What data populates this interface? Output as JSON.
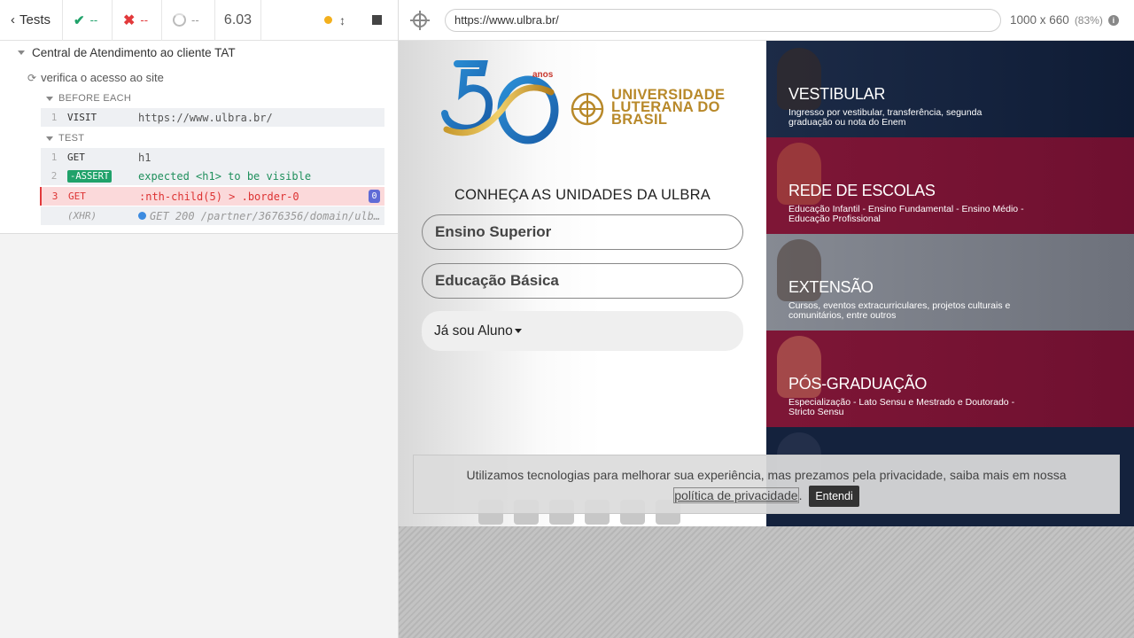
{
  "reporter": {
    "back_label": "Tests",
    "passed": "--",
    "failed": "--",
    "pending": "--",
    "duration": "6.03",
    "suite_title": "Central de Atendimento ao cliente TAT",
    "test_title": "verifica o acesso ao site",
    "hooks": {
      "before_each_label": "BEFORE EACH",
      "test_label": "TEST"
    },
    "before_each_commands": [
      {
        "num": "1",
        "name": "VISIT",
        "message": "https://www.ulbra.br/"
      }
    ],
    "test_commands": [
      {
        "num": "1",
        "name": "GET",
        "message": "h1"
      },
      {
        "num": "2",
        "name": "-ASSERT",
        "message": "expected <h1> to be visible"
      },
      {
        "num": "3",
        "name": "GET",
        "message": ":nth-child(5) > .border-0",
        "badge": "0"
      },
      {
        "num": "",
        "name": "(XHR)",
        "message": "GET 200 /partner/3676356/domain/ulbra.br"
      }
    ]
  },
  "aut": {
    "url": "https://www.ulbra.br/",
    "viewport": "1000 x 660",
    "zoom": "(83%)",
    "info_icon": "i"
  },
  "site": {
    "logo_anos": "anos",
    "university_name_lines": [
      "UNIVERSIDADE",
      "LUTERANA DO",
      "BRASIL"
    ],
    "units_title": "CONHEÇA AS UNIDADES DA ULBRA",
    "buttons": {
      "higher_ed": "Ensino Superior",
      "basic_ed": "Educação Básica",
      "student": "Já sou Aluno"
    },
    "cards": [
      {
        "title": "VESTIBULAR",
        "subtitle": "Ingresso por vestibular, transferência, segunda graduação ou nota do Enem"
      },
      {
        "title": "REDE DE ESCOLAS",
        "subtitle": "Educação Infantil - Ensino Fundamental - Ensino Médio - Educação Profissional"
      },
      {
        "title": "EXTENSÃO",
        "subtitle": "Cursos, eventos extracurriculares, projetos culturais e comunitários, entre outros"
      },
      {
        "title": "PÓS-GRADUAÇÃO",
        "subtitle": "Especialização - Lato Sensu e Mestrado e Doutorado - Stricto Sensu"
      }
    ],
    "cookie": {
      "text": "Utilizamos tecnologias para melhorar sua experiência, mas prezamos pela privacidade, saiba mais em nossa",
      "link": "política de privacidade",
      "after_link": ".",
      "button": "Entendi"
    }
  },
  "colors": {
    "pass": "#20a26a",
    "fail": "#e2393b",
    "ulbra_gold": "#b8892a",
    "card_blue": "#14223d",
    "card_wine": "#7e1636"
  }
}
